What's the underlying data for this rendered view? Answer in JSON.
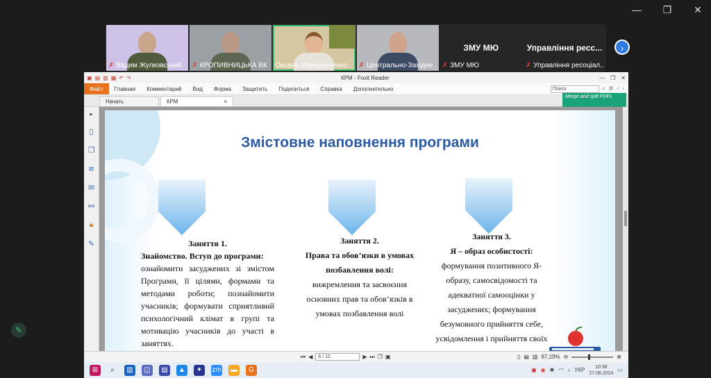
{
  "participants": [
    {
      "name": "Вадим Жулковський",
      "muted": true
    },
    {
      "name": "КРОПИВНИЦЬКА ВК ...",
      "muted": true
    },
    {
      "name": "Оксана Мірошниченко",
      "muted": false,
      "active": true
    },
    {
      "name": "Центрально-Західне ...",
      "muted": true
    },
    {
      "name": "ЗМУ МЮ",
      "title": "ЗМУ МЮ",
      "muted": true
    },
    {
      "name": "Управління ресоціал...",
      "title": "Управління ресс...",
      "muted": true
    }
  ],
  "foxit": {
    "window_title": "КРМ - Foxit Reader",
    "menu": {
      "file": "Файл",
      "items": [
        "Главная",
        "Комментарий",
        "Вид",
        "Форма",
        "Защитить",
        "Поделиться",
        "Справка",
        "Дополнительно"
      ]
    },
    "search_placeholder": "Поиск",
    "merge_banner": "Merge and split PDFs",
    "tabs": [
      "Начать",
      "КРМ"
    ],
    "page_indicator": "6 / 12",
    "zoom": "67,19%"
  },
  "slide": {
    "title": "Змістовне наповнення програми",
    "col1": {
      "heading": "Заняття 1.",
      "subheading": "Знайомство. Вступ до програми:",
      "text": "ознайомити засуджених зі змістом Програми, її цілями, формами та методами роботи; познайомити учасників; формувати сприятливий психологічний клімат в групі та мотивацію учасників до участі в заняттях."
    },
    "col2": {
      "heading": "Заняття 2.",
      "subheading": "Права та обов’язки в умовах позбавлення волі:",
      "text": "вижремлення та засвоєння основних прав та обов’язків в умовах позбавлення волі"
    },
    "col3": {
      "heading": "Заняття 3.",
      "subheading": "Я – образ особистості:",
      "text": "формування позитивного Я-образу, самосвідомості та адекватної самооцінки у засуджених; формування безумовного прийняття себе, усвідомлення і прийняття своїх"
    }
  },
  "taskbar": {
    "language": "УКР",
    "time": "10:38",
    "date": "27.06.2024"
  },
  "colors": {
    "accent_green": "#38c172",
    "foxit_orange": "#e8711a",
    "slide_title": "#2b5aa3"
  }
}
